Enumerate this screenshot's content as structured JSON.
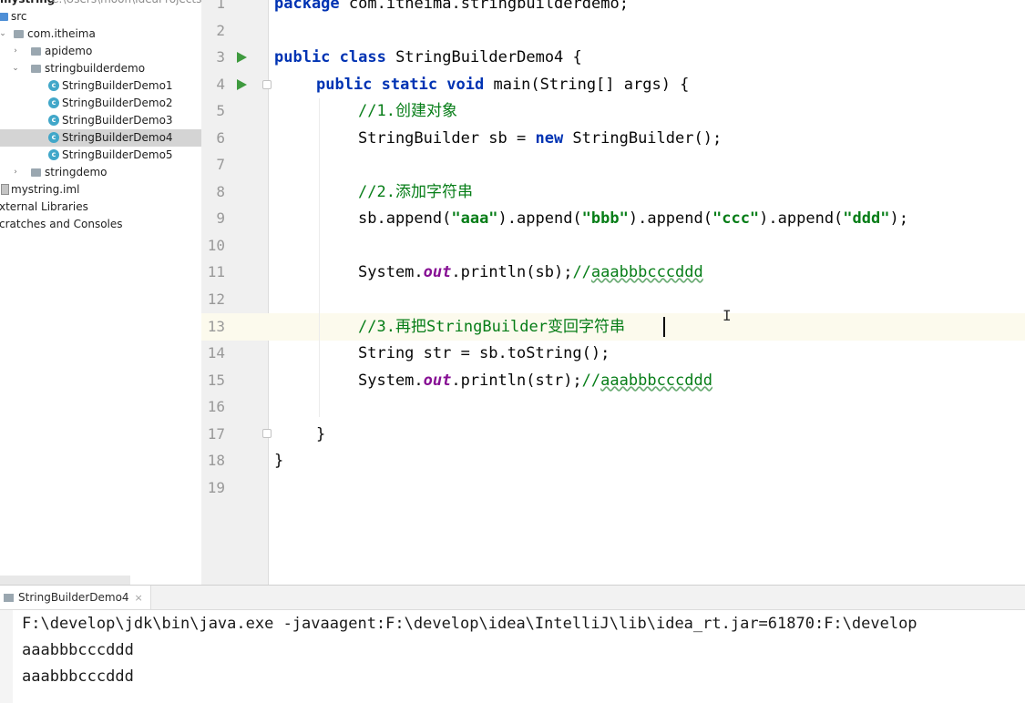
{
  "project_tree": {
    "root_name": "mystring",
    "root_path": "C:\\Users\\moon\\IdeaProjects\\b",
    "items": [
      {
        "label": "src"
      },
      {
        "label": "com.itheima"
      },
      {
        "label": "apidemo"
      },
      {
        "label": "stringbuilderdemo"
      },
      {
        "label": "StringBuilderDemo1"
      },
      {
        "label": "StringBuilderDemo2"
      },
      {
        "label": "StringBuilderDemo3"
      },
      {
        "label": "StringBuilderDemo4"
      },
      {
        "label": "StringBuilderDemo5"
      },
      {
        "label": "stringdemo"
      },
      {
        "label": "mystring.iml"
      },
      {
        "label": "xternal Libraries"
      },
      {
        "label": "cratches and Consoles"
      }
    ]
  },
  "editor": {
    "line_numbers": [
      "1",
      "2",
      "3",
      "4",
      "5",
      "6",
      "7",
      "8",
      "9",
      "10",
      "11",
      "12",
      "13",
      "14",
      "15",
      "16",
      "17",
      "18",
      "19"
    ],
    "code": {
      "l1_kw": "package",
      "l1_rest": " com.itheima.stringbuilderdemo;",
      "l3_kw": "public class",
      "l3_rest": " StringBuilderDemo4 {",
      "l4_kw": "public static void",
      "l4_rest": " main(String[] args) {",
      "l5_cmt": "//1.创建对象",
      "l6_a": "StringBuilder sb = ",
      "l6_kw": "new",
      "l6_b": " StringBuilder();",
      "l8_cmt": "//2.添加字符串",
      "l9_a": "sb.append(",
      "l9_s1": "\"aaa\"",
      "l9_b": ").append(",
      "l9_s2": "\"bbb\"",
      "l9_c": ").append(",
      "l9_s3": "\"ccc\"",
      "l9_d": ").append(",
      "l9_s4": "\"ddd\"",
      "l9_e": ");",
      "l11_a": "System.",
      "l11_field": "out",
      "l11_b": ".println(sb);",
      "l11_cmt": "//",
      "l11_cmt2": "aaabbbcccddd",
      "l13_cmt": "//3.再把StringBuilder变回字符串",
      "l14": "String str = sb.toString();",
      "l15_a": "System.",
      "l15_field": "out",
      "l15_b": ".println(str);",
      "l15_cmt": "//",
      "l15_cmt2": "aaabbbcccddd",
      "l17": "}",
      "l18": "}"
    },
    "cursor_glyph": "I"
  },
  "run_panel": {
    "tab_label": "StringBuilderDemo4",
    "close_glyph": "×",
    "lines": [
      "F:\\develop\\jdk\\bin\\java.exe -javaagent:F:\\develop\\idea\\IntelliJ\\lib\\idea_rt.jar=61870:F:\\develop",
      "aaabbbcccddd",
      "aaabbbcccddd"
    ]
  },
  "colors": {
    "keyword": "#0033b3",
    "string": "#067d17",
    "comment": "#8c8c8c",
    "field": "#871094",
    "run_icon": "#3e9a3e",
    "current_line": "#fcfaed"
  }
}
